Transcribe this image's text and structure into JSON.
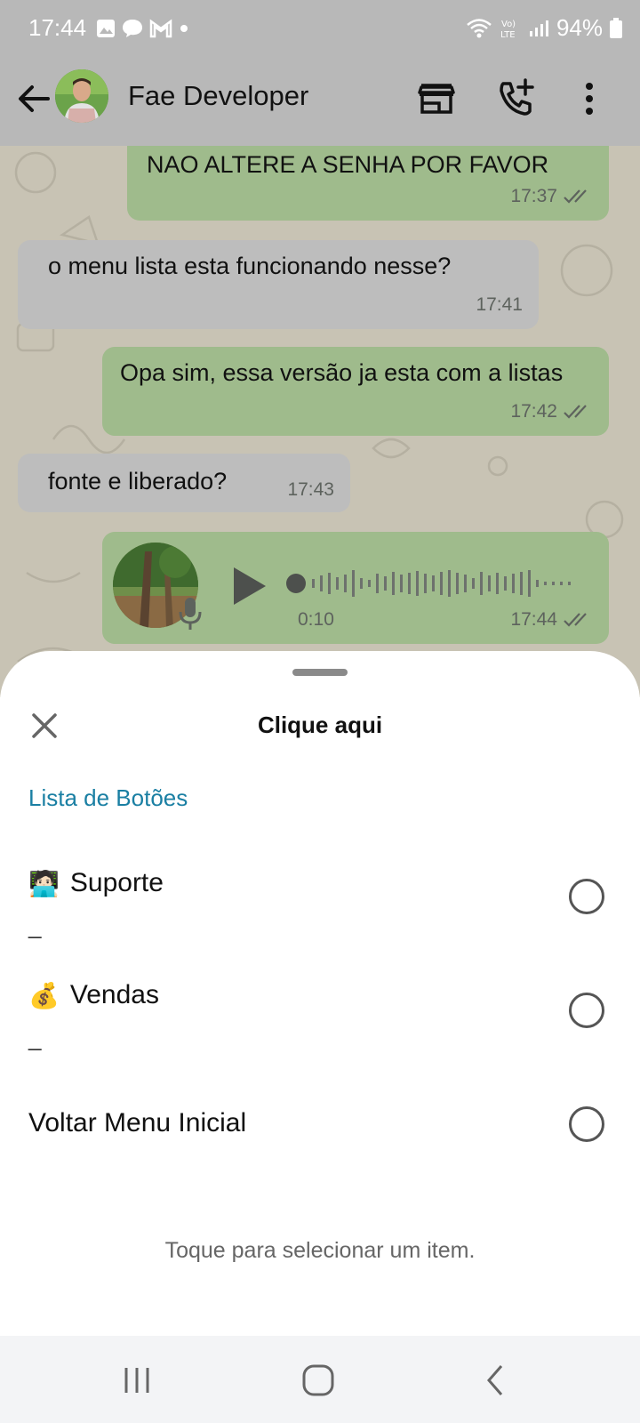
{
  "status_bar": {
    "time": "17:44",
    "battery": "94%",
    "left_icons": [
      "gallery-icon",
      "chat-icon",
      "gmail-icon",
      "dot-icon"
    ],
    "right_icons": [
      "wifi-icon",
      "volte-icon",
      "signal-icon",
      "battery-icon"
    ]
  },
  "header": {
    "contact_name": "Fae Developer",
    "icons": [
      "back-arrow-icon",
      "store-icon",
      "add-call-icon",
      "more-vert-icon"
    ]
  },
  "messages": [
    {
      "direction": "out",
      "text": "NAO ALTERE A SENHA POR FAVOR",
      "time": "17:37",
      "read": true
    },
    {
      "direction": "in",
      "text": "o menu lista esta funcionando nesse?",
      "time": "17:41"
    },
    {
      "direction": "out",
      "text": "Opa sim, essa versão ja esta com a listas",
      "time": "17:42",
      "read": true
    },
    {
      "direction": "in",
      "text": "fonte e liberado?",
      "time": "17:43"
    },
    {
      "direction": "out",
      "type": "voice",
      "duration": "0:10",
      "time": "17:44",
      "read": true
    }
  ],
  "sheet": {
    "title": "Clique aqui",
    "section_title": "Lista de Botões",
    "options": [
      {
        "emoji": "🧑🏻‍💻",
        "label": "Suporte",
        "description": "_"
      },
      {
        "emoji": "💰",
        "label": "Vendas",
        "description": "_"
      },
      {
        "emoji": "",
        "label": "Voltar Menu Inicial",
        "description": ""
      }
    ],
    "hint": "Toque para selecionar um item."
  },
  "colors": {
    "outgoing_bubble": "#9fbb8c",
    "incoming_bubble": "#bdbdbd",
    "section_title": "#1a7fa3",
    "header_bg": "#b8b8b8"
  }
}
